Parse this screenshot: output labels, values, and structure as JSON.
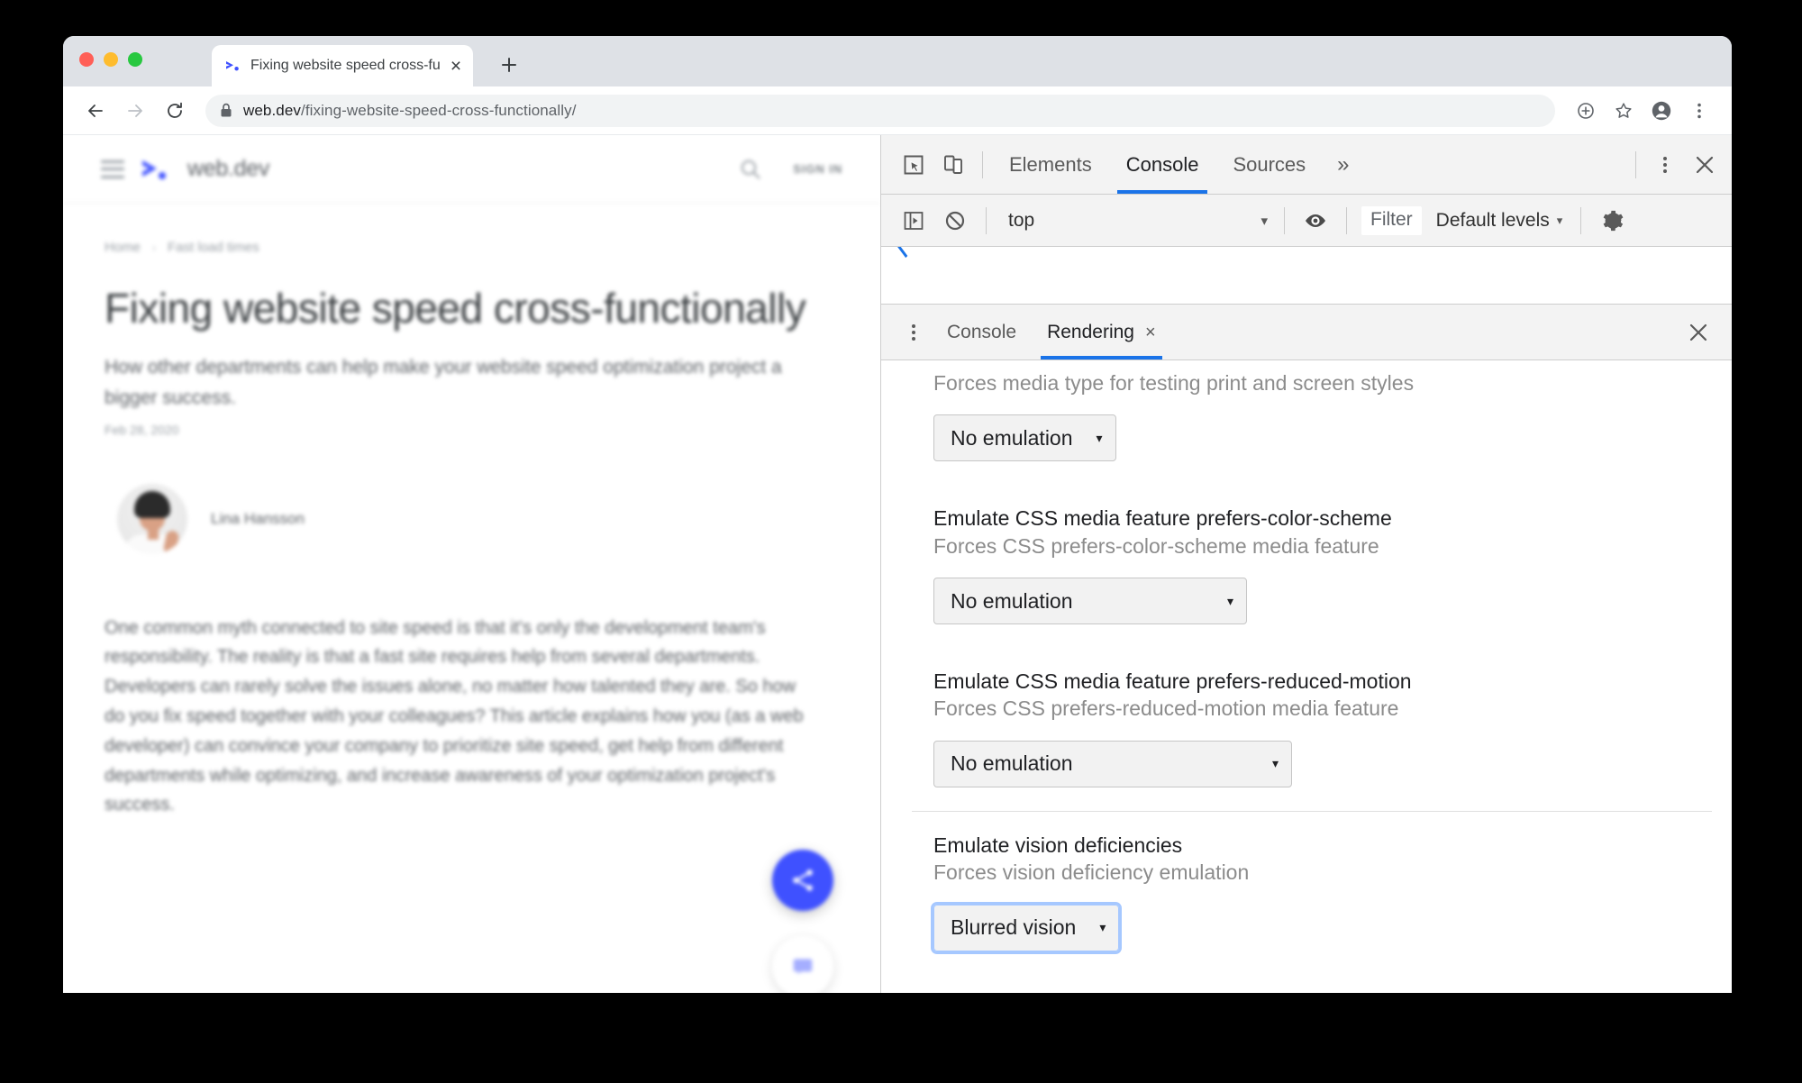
{
  "browser": {
    "tab": {
      "title": "Fixing website speed cross-fun",
      "favicon": "webdev-logo-icon",
      "close_label": "×"
    },
    "new_tab_label": "+",
    "nav": {
      "back_label": "←",
      "forward_label": "→",
      "reload_label": "↻"
    },
    "omnibox": {
      "host": "web.dev",
      "path": "/fixing-website-speed-cross-functionally/",
      "lock_icon": "lock-icon"
    },
    "toolbar_icons": [
      "add-to-desktop-icon",
      "bookmark-star-icon",
      "profile-avatar-icon",
      "chrome-menu-icon"
    ]
  },
  "page": {
    "header": {
      "menu_icon": "hamburger-menu-icon",
      "logo_icon": "webdev-logo-icon",
      "site_name": "web.dev",
      "search_icon": "search-icon",
      "signin_label": "SIGN IN"
    },
    "breadcrumb": [
      {
        "label": "Home"
      },
      {
        "label": "Fast load times"
      }
    ],
    "breadcrumb_separator": "›",
    "title": "Fixing website speed cross-functionally",
    "subtitle": "How other departments can help make your website speed optimization project a bigger success.",
    "date": "Feb 28, 2020",
    "author": {
      "name": "Lina Hansson",
      "avatar": "author-avatar"
    },
    "body": "One common myth connected to site speed is that it's only the development team's responsibility. The reality is that a fast site requires help from several departments. Developers can rarely solve the issues alone, no matter how talented they are. So how do you fix speed together with your colleagues? This article explains how you (as a web developer) can convince your company to prioritize site speed, get help from different departments while optimizing, and increase awareness of your optimization project's success.",
    "fab_share_icon": "share-icon",
    "fab_feedback_icon": "feedback-icon",
    "fab_share_color": "#3f51ff"
  },
  "devtools": {
    "toolbar": {
      "inspect_icon": "inspect-element-icon",
      "device_toolbar_icon": "device-toolbar-icon",
      "tabs": [
        {
          "label": "Elements",
          "active": false
        },
        {
          "label": "Console",
          "active": true
        },
        {
          "label": "Sources",
          "active": false
        }
      ],
      "more_tabs_label": "»",
      "menu_icon": "devtools-menu-icon",
      "close_icon": "close-icon",
      "accent": "#1a73e8"
    },
    "console_bar": {
      "sidebar_toggle_icon": "console-sidebar-icon",
      "clear_icon": "clear-console-icon",
      "context": "top",
      "context_caret": "▾",
      "eye_icon": "live-expression-icon",
      "filter_placeholder": "Filter",
      "levels": "Default levels",
      "levels_caret": "▾",
      "settings_icon": "gear-icon"
    },
    "drawer": {
      "menu_icon": "drawer-menu-icon",
      "tabs": [
        {
          "label": "Console",
          "active": false,
          "closable": false
        },
        {
          "label": "Rendering",
          "active": true,
          "closable": true,
          "close_label": "×"
        }
      ],
      "close_icon": "close-icon"
    },
    "rendering": {
      "sections": [
        {
          "title": "",
          "desc": "Forces media type for testing print and screen styles",
          "select_value": "No emulation",
          "caret": "▾",
          "focused": false,
          "divider": false
        },
        {
          "title": "Emulate CSS media feature prefers-color-scheme",
          "desc": "Forces CSS prefers-color-scheme media feature",
          "select_value": "No emulation",
          "caret": "▾",
          "focused": false,
          "divider": false
        },
        {
          "title": "Emulate CSS media feature prefers-reduced-motion",
          "desc": "Forces CSS prefers-reduced-motion media feature",
          "select_value": "No emulation",
          "caret": "▾",
          "focused": false,
          "divider": false
        },
        {
          "title": "Emulate vision deficiencies",
          "desc": "Forces vision deficiency emulation",
          "select_value": "Blurred vision",
          "caret": "▾",
          "focused": true,
          "divider": true
        }
      ]
    }
  }
}
